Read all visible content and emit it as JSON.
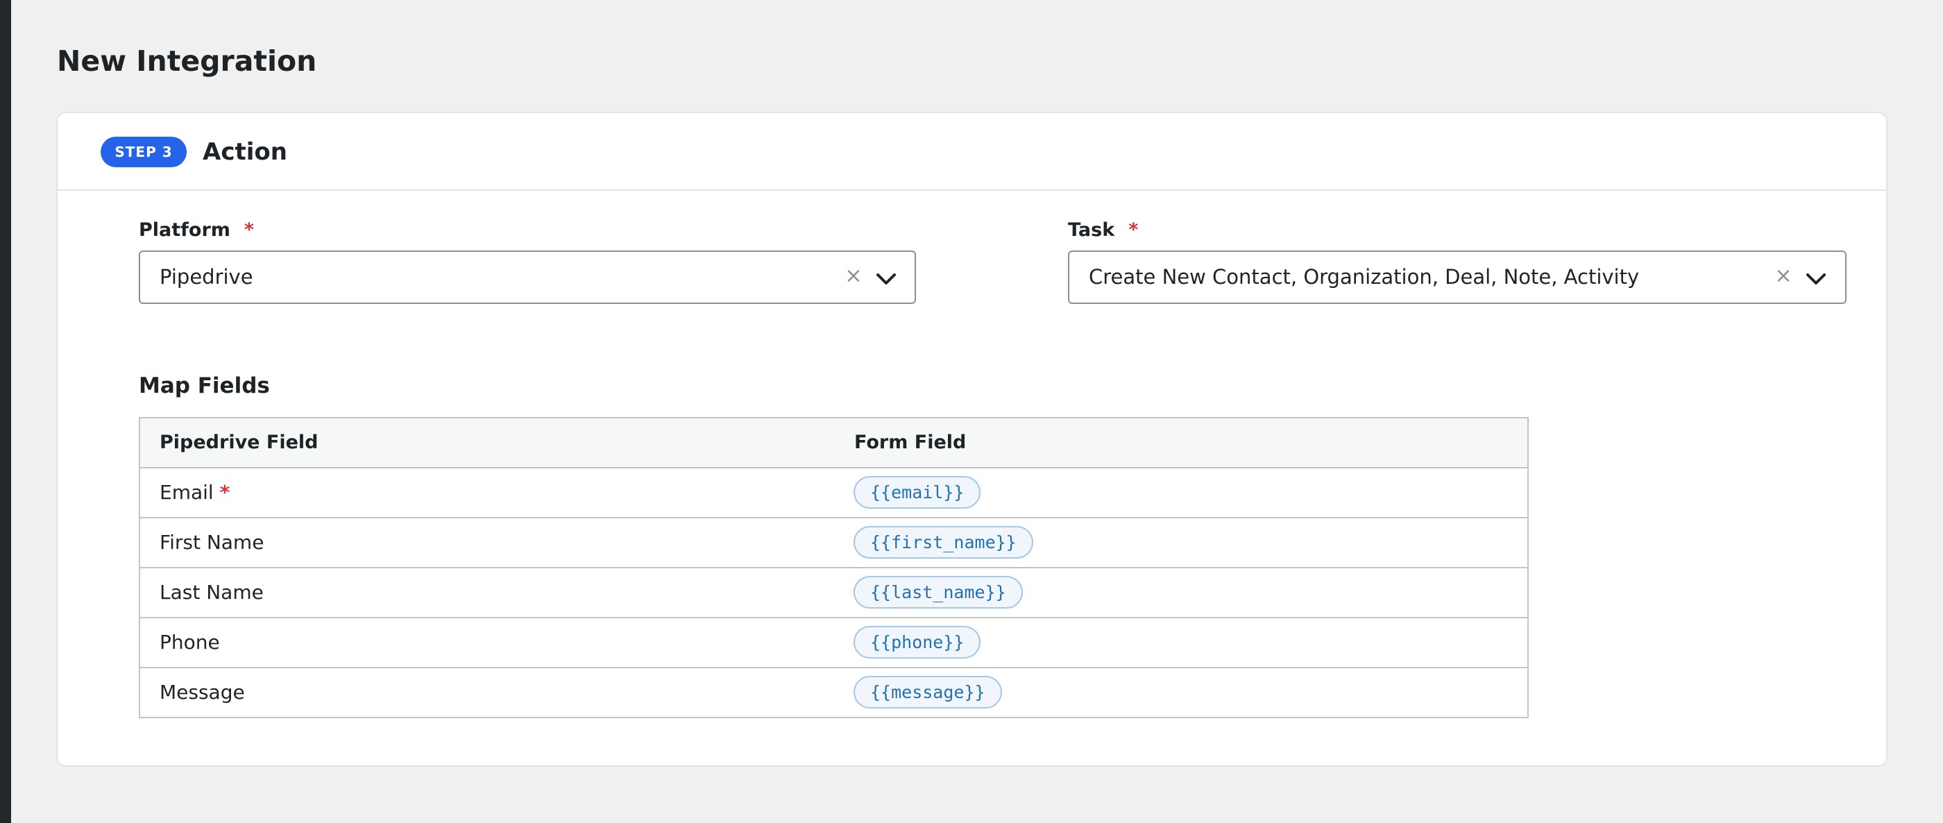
{
  "page": {
    "title": "New Integration"
  },
  "step": {
    "badge": "STEP 3",
    "title": "Action"
  },
  "platform": {
    "label": "Platform",
    "required_mark": "*",
    "value": "Pipedrive",
    "clear": "×"
  },
  "task": {
    "label": "Task",
    "required_mark": "*",
    "value": "Create New Contact, Organization, Deal, Note, Activity",
    "clear": "×"
  },
  "map_fields": {
    "title": "Map Fields",
    "columns": [
      "Pipedrive Field",
      "Form Field"
    ],
    "rows": [
      {
        "field": "Email",
        "required": "*",
        "token": "{{email}}"
      },
      {
        "field": "First Name",
        "token": "{{first_name}}"
      },
      {
        "field": "Last Name",
        "token": "{{last_name}}"
      },
      {
        "field": "Phone",
        "token": "{{phone}}"
      },
      {
        "field": "Message",
        "token": "{{message}}"
      }
    ]
  },
  "colors": {
    "accent": "#2563eb",
    "required": "#d63638",
    "token_text": "#2271b1"
  },
  "icons": {
    "clear": "close-icon",
    "dropdown": "chevron-down-icon"
  }
}
